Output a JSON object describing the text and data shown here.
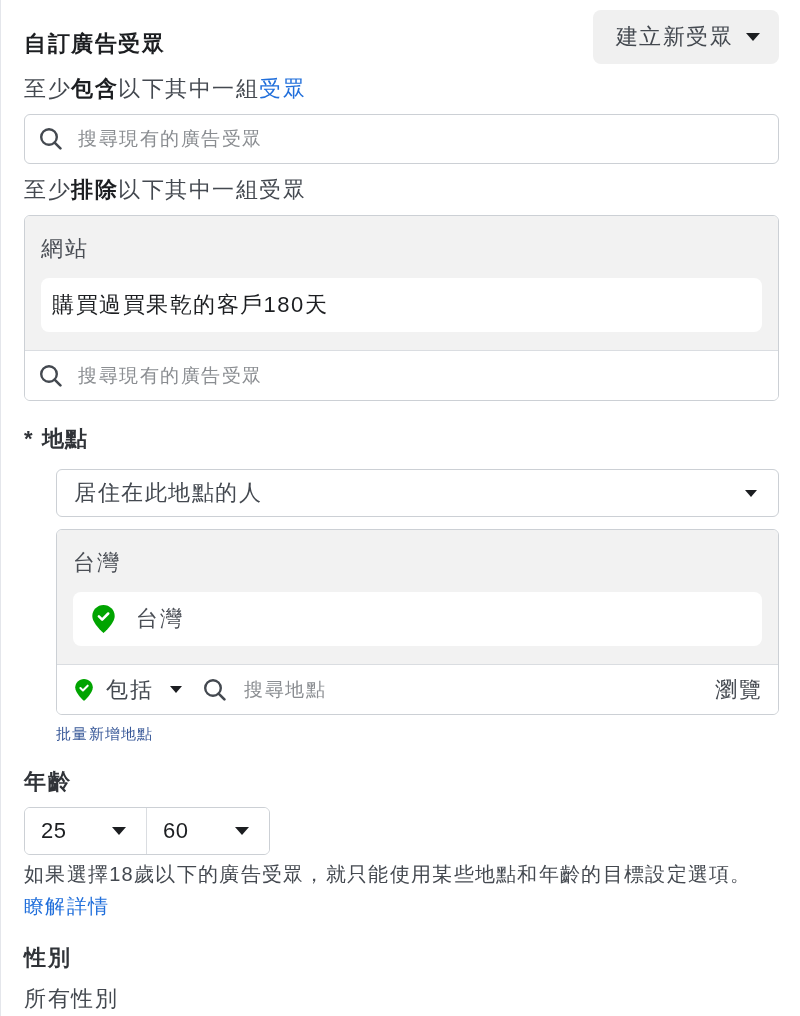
{
  "custom_audience": {
    "title": "自訂廣告受眾",
    "create_button": "建立新受眾",
    "include": {
      "text": "至少**包含**以下其中一組",
      "link": "受眾",
      "search": {
        "placeholder": "搜尋現有的廣告受眾"
      }
    },
    "exclude": {
      "text": "至少**排除**以下其中一組受眾",
      "groups": [
        {
          "title": "網站",
          "items": [
            {
              "name": "購買過買果乾的客戶180天"
            }
          ]
        }
      ],
      "search": {
        "placeholder": "搜尋現有的廣告受眾"
      }
    }
  },
  "location": {
    "label": "* 地點",
    "type_dropdown": "居住在此地點的人",
    "groups": [
      {
        "title": "台灣",
        "items": [
          {
            "name": "台灣",
            "included": true
          }
        ]
      }
    ],
    "filter": {
      "mode": "包括",
      "placeholder": "搜尋地點",
      "browse": "瀏覽"
    },
    "bulk_add_link": "批量新增地點"
  },
  "age": {
    "label": "年齡",
    "min": "25",
    "max": "60",
    "note": "如果選擇18歲以下的廣告受眾，就只能使用某些地點和年齡的目標設定選項。",
    "note_link": "瞭解詳情"
  },
  "gender": {
    "label": "性別",
    "value": "所有性別"
  }
}
